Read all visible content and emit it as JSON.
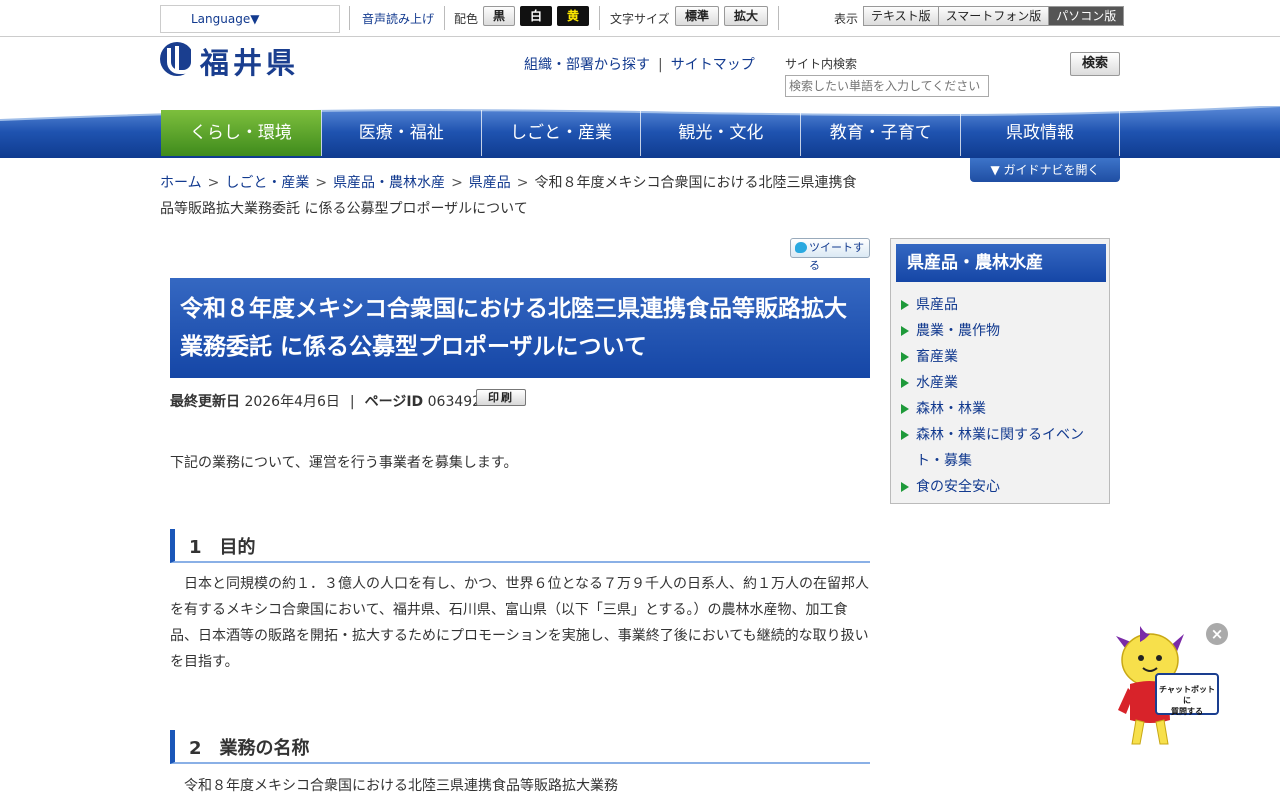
{
  "utility": {
    "language": "Language▼",
    "voice": "音声読み上げ",
    "color_label": "配色",
    "color_black": "黒",
    "color_white": "白",
    "color_yellow": "黄",
    "fontsize_label": "文字サイズ",
    "fontsize_normal": "標準",
    "fontsize_large": "拡大",
    "display_label": "表示",
    "display_text": "テキスト版",
    "display_smartphone": "スマートフォン版",
    "display_pc": "パソコン版"
  },
  "header": {
    "logo_text": "福井県",
    "link_org": "組織・部署から探す",
    "link_sitemap": "サイトマップ",
    "search_label": "サイト内検索",
    "search_placeholder": "検索したい単語を入力してください",
    "search_button": "検索"
  },
  "nav": {
    "items": [
      "くらし・環境",
      "医療・福祉",
      "しごと・産業",
      "観光・文化",
      "教育・子育て",
      "県政情報"
    ]
  },
  "guide_button": "▼ ガイドナビを開く",
  "breadcrumb": {
    "home": "ホーム",
    "c1": "しごと・産業",
    "c2": "県産品・農林水産",
    "c3": "県産品",
    "current": "令和８年度メキシコ合衆国における北陸三県連携食品等販路拡大業務委託 に係る公募型プロポーザルについて"
  },
  "tweet": "ツイートする",
  "page": {
    "title": "令和８年度メキシコ合衆国における北陸三県連携食品等販路拡大業務委託 に係る公募型プロポーザルについて",
    "updated_label": "最終更新日",
    "updated_value": "2026年4月6日",
    "page_id_label": "ページID",
    "page_id_value": "063492",
    "print": "印刷",
    "intro": "下記の業務について、運営を行う事業者を募集します。",
    "sec1_heading": "1　目的",
    "sec1_body": "日本と同規模の約１．３億人の人口を有し、かつ、世界６位となる７万９千人の日系人、約１万人の在留邦人を有するメキシコ合衆国において、福井県、石川県、富山県（以下「三県」とする。）の農林水産物、加工食品、日本酒等の販路を開拓・拡大するためにプロモーションを実施し、事業終了後においても継続的な取り扱いを目指す。",
    "sec2_heading": "2　業務の名称",
    "sec2_body": "令和８年度メキシコ合衆国における北陸三県連携食品等販路拡大業務"
  },
  "sidebar": {
    "title": "県産品・農林水産",
    "items": [
      "県産品",
      "農業・農作物",
      "畜産業",
      "水産業",
      "森林・林業",
      "森林・林業に関するイベント・募集",
      "食の安全安心"
    ]
  },
  "chatbot": {
    "sign_line1": "チャットボットに",
    "sign_line2": "質問する",
    "close": "×"
  },
  "colors": {
    "accent_blue": "#1546a6",
    "nav_active_green": "#3f8b1c",
    "link_blue": "#123a8f"
  }
}
